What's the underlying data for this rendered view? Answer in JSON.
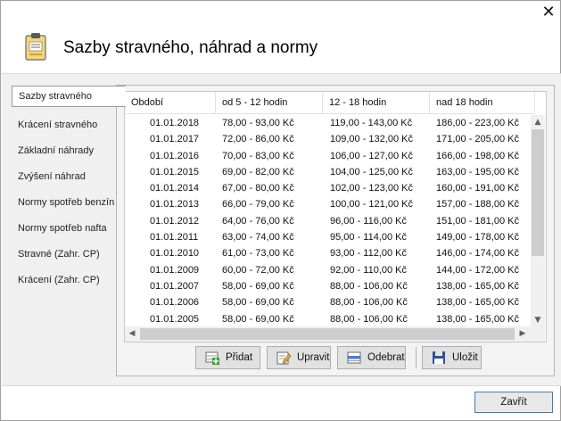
{
  "dialog": {
    "title": "Sazby stravného, náhrad a normy",
    "close_glyph": "✕",
    "close_button": "Zavřít"
  },
  "sidebar": {
    "items": [
      {
        "label": "Sazby stravného"
      },
      {
        "label": "Krácení stravného"
      },
      {
        "label": "Základní náhrady"
      },
      {
        "label": "Zvýšení náhrad"
      },
      {
        "label": "Normy spotřeb benzín"
      },
      {
        "label": "Normy spotřeb nafta"
      },
      {
        "label": "Stravné (Zahr. CP)"
      },
      {
        "label": "Krácení (Zahr. CP)"
      }
    ],
    "active_index": 0
  },
  "table": {
    "headers": [
      "Období",
      "od 5 - 12 hodin",
      "12 - 18 hodin",
      "nad 18 hodin"
    ],
    "rows": [
      [
        "01.01.2018",
        "78,00 - 93,00 Kč",
        "119,00 - 143,00 Kč",
        "186,00 - 223,00 Kč"
      ],
      [
        "01.01.2017",
        "72,00 - 86,00 Kč",
        "109,00 - 132,00 Kč",
        "171,00 - 205,00 Kč"
      ],
      [
        "01.01.2016",
        "70,00 - 83,00 Kč",
        "106,00 - 127,00 Kč",
        "166,00 - 198,00 Kč"
      ],
      [
        "01.01.2015",
        "69,00 - 82,00 Kč",
        "104,00 - 125,00 Kč",
        "163,00 - 195,00 Kč"
      ],
      [
        "01.01.2014",
        "67,00 - 80,00 Kč",
        "102,00 - 123,00 Kč",
        "160,00 - 191,00 Kč"
      ],
      [
        "01.01.2013",
        "66,00 - 79,00 Kč",
        "100,00 - 121,00 Kč",
        "157,00 - 188,00 Kč"
      ],
      [
        "01.01.2012",
        "64,00 - 76,00 Kč",
        "96,00 - 116,00 Kč",
        "151,00 - 181,00 Kč"
      ],
      [
        "01.01.2011",
        "63,00 - 74,00 Kč",
        "95,00 - 114,00 Kč",
        "149,00 - 178,00 Kč"
      ],
      [
        "01.01.2010",
        "61,00 - 73,00 Kč",
        "93,00 - 112,00 Kč",
        "146,00 - 174,00 Kč"
      ],
      [
        "01.01.2009",
        "60,00 - 72,00 Kč",
        "92,00 - 110,00 Kč",
        "144,00 - 172,00 Kč"
      ],
      [
        "01.01.2007",
        "58,00 - 69,00 Kč",
        "88,00 - 106,00 Kč",
        "138,00 - 165,00 Kč"
      ],
      [
        "01.01.2006",
        "58,00 - 69,00 Kč",
        "88,00 - 106,00 Kč",
        "138,00 - 165,00 Kč"
      ],
      [
        "01.01.2005",
        "58,00 - 69,00 Kč",
        "88,00 - 106,00 Kč",
        "138,00 - 165,00 Kč"
      ]
    ]
  },
  "scroll": {
    "up": "▲",
    "down": "▼",
    "left": "◀",
    "right": "▶"
  },
  "toolbar": {
    "add": {
      "label": "Přidat",
      "icon": "add-row-icon"
    },
    "edit": {
      "label": "Upravit",
      "icon": "edit-icon"
    },
    "remove": {
      "label": "Odebrat",
      "icon": "remove-row-icon"
    },
    "save": {
      "label": "Uložit",
      "icon": "floppy-disk-icon"
    }
  },
  "colors": {
    "window_bg": "#ffffff",
    "content_bg": "#f0f0f0",
    "button_bg": "#e1e1e1",
    "default_button_border": "#3c7fb1"
  }
}
